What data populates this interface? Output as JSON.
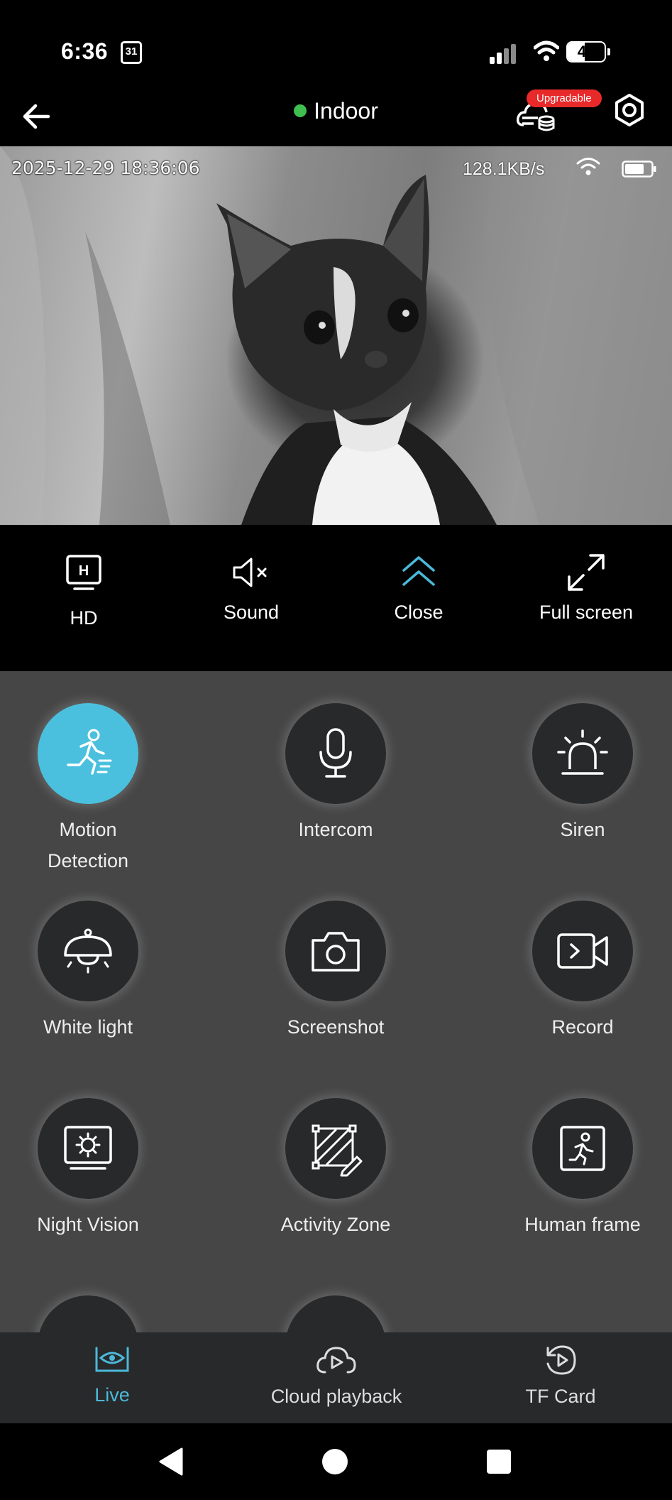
{
  "status_bar": {
    "time": "6:36",
    "calendar_day": "31",
    "battery_level": "47",
    "battery_percent": 47
  },
  "header": {
    "back_icon": "arrow-left-icon",
    "device_name": "Indoor",
    "online_color": "#3fbf4f",
    "upgrade_badge": "Upgradable",
    "settings_icon": "hexagon-gear-icon"
  },
  "video": {
    "timestamp": "2025-12-29 18:36:06",
    "bitrate": "128.1KB/s"
  },
  "controls": [
    {
      "label": "HD",
      "icon": "hd-monitor-icon"
    },
    {
      "label": "Sound",
      "icon": "speaker-mute-icon"
    },
    {
      "label": "Close",
      "icon": "double-chevron-up-icon",
      "accent": "#4bb9d9"
    },
    {
      "label": "Full screen",
      "icon": "expand-icon"
    }
  ],
  "functions": [
    {
      "label": "Motion Detection",
      "icon": "running-person-icon",
      "active": true
    },
    {
      "label": "Intercom",
      "icon": "microphone-icon"
    },
    {
      "label": "Siren",
      "icon": "siren-icon"
    },
    {
      "label": "White light",
      "icon": "ceiling-lamp-icon"
    },
    {
      "label": "Screenshot",
      "icon": "camera-icon"
    },
    {
      "label": "Record",
      "icon": "video-record-icon"
    },
    {
      "label": "Night Vision",
      "icon": "night-vision-icon"
    },
    {
      "label": "Activity Zone",
      "icon": "activity-zone-icon"
    },
    {
      "label": "Human frame",
      "icon": "human-frame-icon"
    }
  ],
  "bottom_nav": [
    {
      "label": "Live",
      "icon": "eye-icon",
      "active": true
    },
    {
      "label": "Cloud playback",
      "icon": "cloud-play-icon"
    },
    {
      "label": "TF Card",
      "icon": "replay-icon"
    }
  ],
  "colors": {
    "accent": "#4bb9d9",
    "active_function": "#4bc0de",
    "badge": "#e8292a",
    "panel_bg": "#464646",
    "button_bg": "#28292b"
  }
}
